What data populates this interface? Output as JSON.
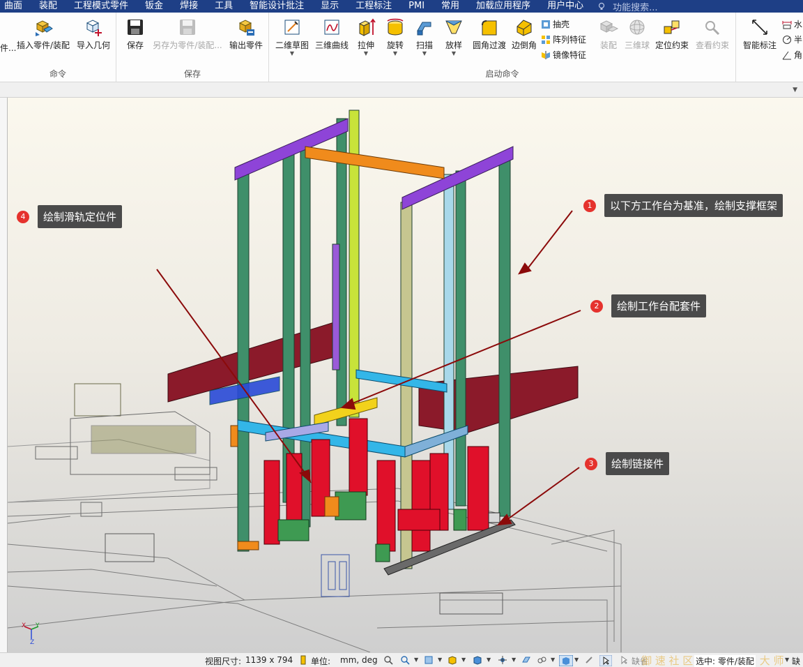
{
  "menu": {
    "items": [
      "曲面",
      "装配",
      "工程模式零件",
      "钣金",
      "焊接",
      "工具",
      "智能设计批注",
      "显示",
      "工程标注",
      "PMI",
      "常用",
      "加载应用程序",
      "用户中心"
    ],
    "search_placeholder": "功能搜索..."
  },
  "ribbon": {
    "groups": {
      "command": "命令",
      "save": "保存",
      "launch": "启动命令"
    },
    "buttons": {
      "insert_part_cut": "件...",
      "insert_part": "插入零件/装配",
      "import_geometry": "导入几何",
      "save": "保存",
      "save_as": "另存为零件/装配...",
      "export_part": "输出零件",
      "sketch_2d": "二维草图",
      "curve_3d": "三维曲线",
      "extrude": "拉伸",
      "revolve": "旋转",
      "sweep": "扫描",
      "loft": "放样",
      "fillet": "圆角过渡",
      "chamfer": "边倒角",
      "shell": "抽壳",
      "pattern": "阵列特征",
      "mirror": "镜像特征",
      "assembly": "装配",
      "ball_3d": "三维球",
      "position_constraint": "定位约束",
      "view_constraint": "查看约束",
      "smart_dim": "智能标注",
      "right_1": "水",
      "right_2": "半",
      "right_3": "角"
    }
  },
  "callouts": [
    {
      "num": "1",
      "text": "以下方工作台为基准，绘制支撑框架"
    },
    {
      "num": "2",
      "text": "绘制工作台配套件"
    },
    {
      "num": "3",
      "text": "绘制链接件"
    },
    {
      "num": "4",
      "text": "绘制滑轨定位件"
    }
  ],
  "axes": {
    "x": "X",
    "y": "Y",
    "z": "Z"
  },
  "status": {
    "view_size_label": "视图尺寸:",
    "view_size": "1139 x  794",
    "unit_label": "单位:",
    "unit_value": "mm, deg",
    "default_label": "缺省",
    "selection": "选中: 零件/装配",
    "right_cut": "缺",
    "watermark": "御 速 社 区 | CAXA数 码 大 师"
  },
  "colors": {
    "menubar": "#1e3f86",
    "frame_green": "#3f8f6a",
    "purple": "#8e44d8",
    "orange": "#f08b1c",
    "red": "#e0102a",
    "maroon": "#8b1a2a",
    "cyan": "#33b6e8",
    "yellow": "#f2d21c",
    "callout_badge": "#e5322d",
    "callout_bg": "#4a4a4a"
  }
}
